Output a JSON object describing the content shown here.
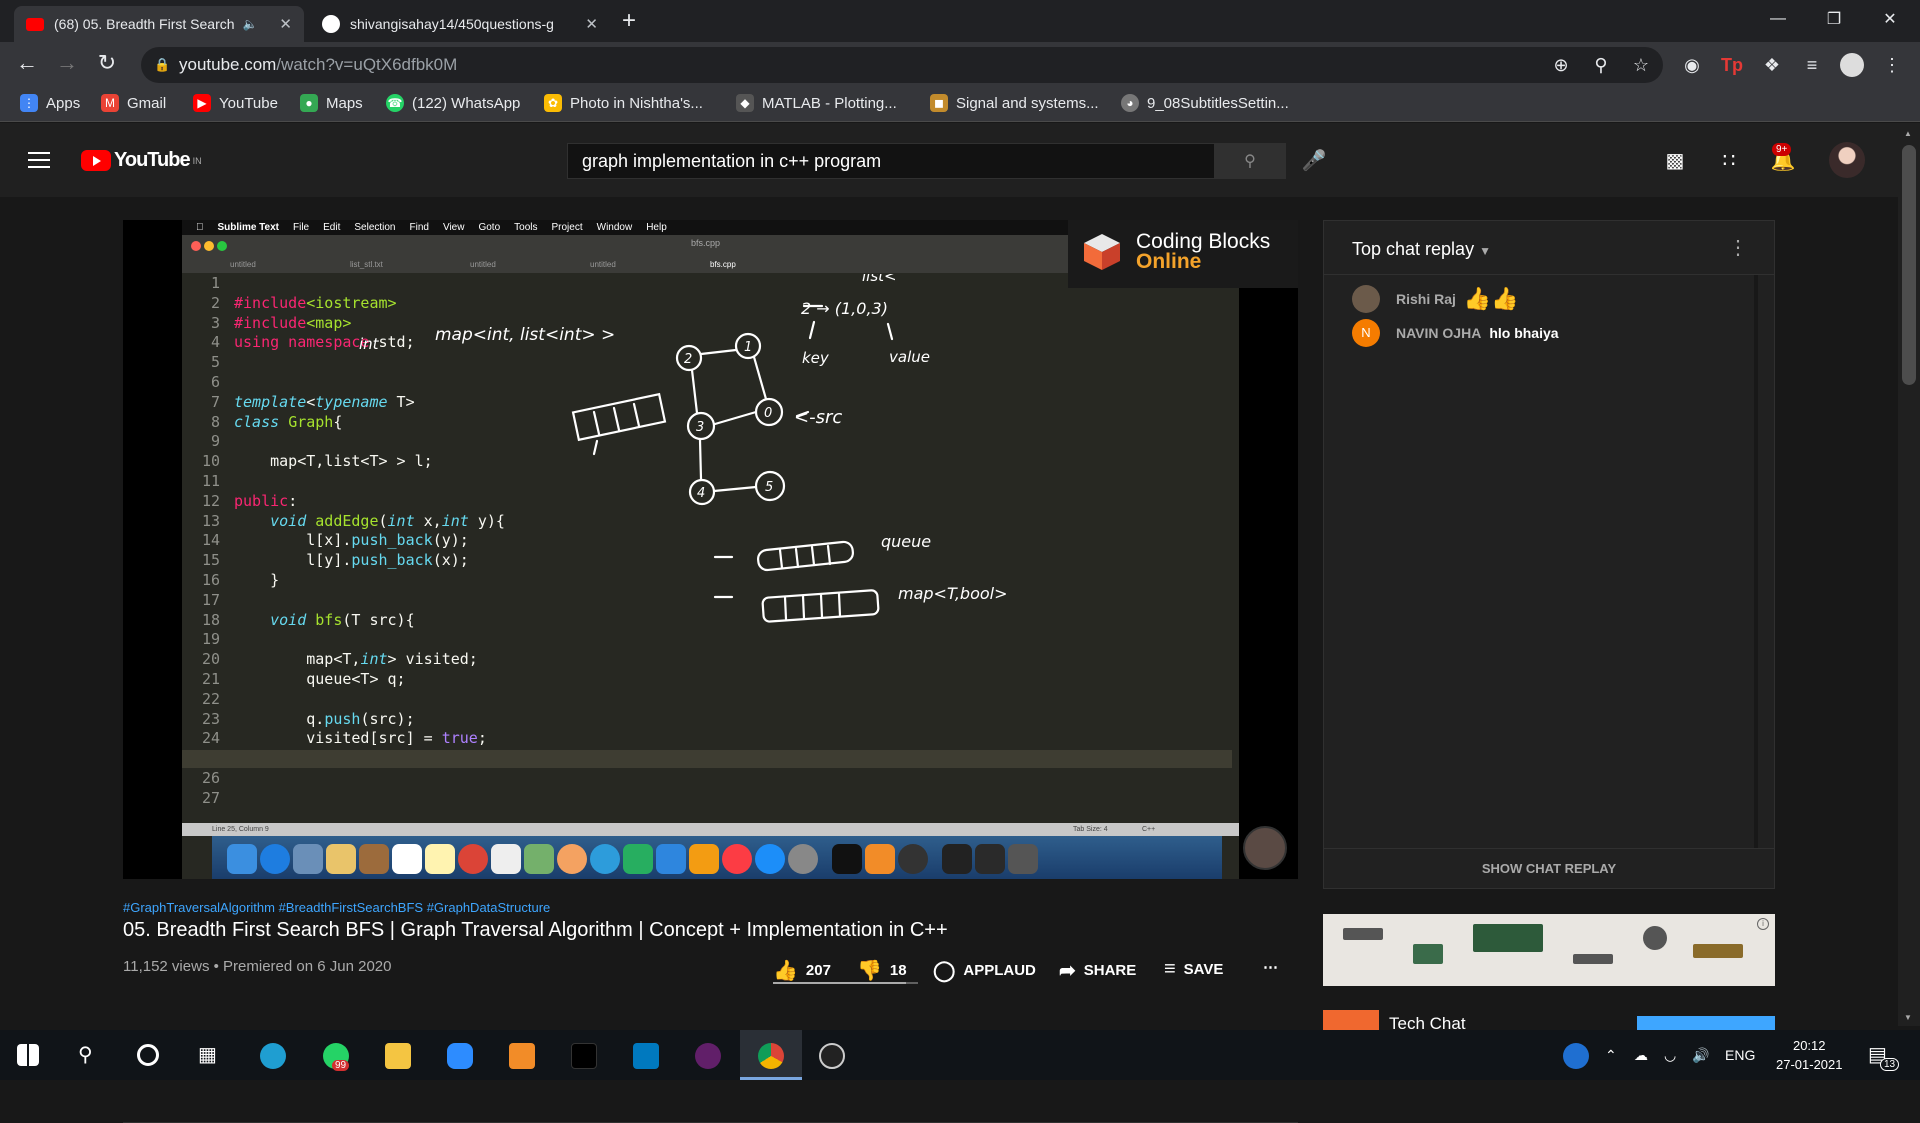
{
  "browser": {
    "tabs": [
      {
        "title": "(68) 05. Breadth First Search",
        "icon": "youtube-icon"
      },
      {
        "title": "shivangisahay14/450questions-g",
        "icon": "github-icon"
      }
    ],
    "url_host": "youtube.com",
    "url_path": "/watch?v=uQtX6dfbk0M",
    "bookmarks": [
      "Apps",
      "Gmail",
      "YouTube",
      "Maps",
      "(122) WhatsApp",
      "Photo in Nishtha's...",
      "MATLAB - Plotting...",
      "Signal and systems...",
      "9_08SubtitlesSettin..."
    ]
  },
  "youtube": {
    "country": "IN",
    "search_query": "graph implementation in c++ program",
    "notifications": "9+"
  },
  "video": {
    "editor_app": "Sublime Text",
    "editor_menu": [
      "File",
      "Edit",
      "Selection",
      "Find",
      "View",
      "Goto",
      "Tools",
      "Project",
      "Window",
      "Help"
    ],
    "file_name": "bfs.cpp",
    "editor_tabs": [
      "untitled",
      "list_stl.txt",
      "untitled",
      "untitled",
      "bfs.cpp"
    ],
    "code_lines": [
      "#include<iostream>",
      "#include<map>",
      "using namespace std;",
      "",
      "",
      "template<typename T>",
      "class Graph{",
      "",
      "    map<T,list<T> > l;",
      "",
      "public:",
      "    void addEdge(int x,int y){",
      "        l[x].push_back(y);",
      "        l[y].push_back(x);",
      "    }",
      "",
      "    void bfs(T src){",
      "",
      "        map<T,int> visited;",
      "        queue<T> q;",
      "",
      "        q.push(src);",
      "        visited[src] = true;",
      "",
      "",
      "",
      ""
    ],
    "status_left": "Line 25, Column 9",
    "status_right": "Tab Size: 4",
    "status_lang": "C++",
    "overlay_brand_line1": "Coding Blocks",
    "overlay_brand_line2": "Online",
    "handwriting": {
      "map_list": "map<int, list<int> >",
      "int_note": "int",
      "list_label": "list<",
      "key_label": "key",
      "value_label": "value",
      "src_label": "<-src",
      "queue_label": "queue",
      "visited_label": "map<T,bool>"
    }
  },
  "meta": {
    "hashtags": "#GraphTraversalAlgorithm #BreadthFirstSearchBFS #GraphDataStructure",
    "title": "05. Breadth First Search BFS | Graph Traversal Algorithm | Concept + Implementation in C++",
    "views": "11,152 views • Premiered on 6 Jun 2020",
    "likes": "207",
    "dislikes": "18",
    "like_fraction": 0.92,
    "applaud": "APPLAUD",
    "share": "SHARE",
    "save": "SAVE"
  },
  "chat": {
    "header": "Top chat replay",
    "messages": [
      {
        "author": "Rishi Raj",
        "text": "👍👍"
      },
      {
        "author": "NAVIN OJHA",
        "text": "hlo bhaiya",
        "initial": "N"
      }
    ],
    "show_replay": "SHOW CHAT REPLAY"
  },
  "sidebar": {
    "next_title": "Tech Chat"
  },
  "taskbar": {
    "lang": "ENG",
    "time": "20:12",
    "date": "27-01-2021",
    "notif_count": "13",
    "whatsapp_badge": "99"
  }
}
